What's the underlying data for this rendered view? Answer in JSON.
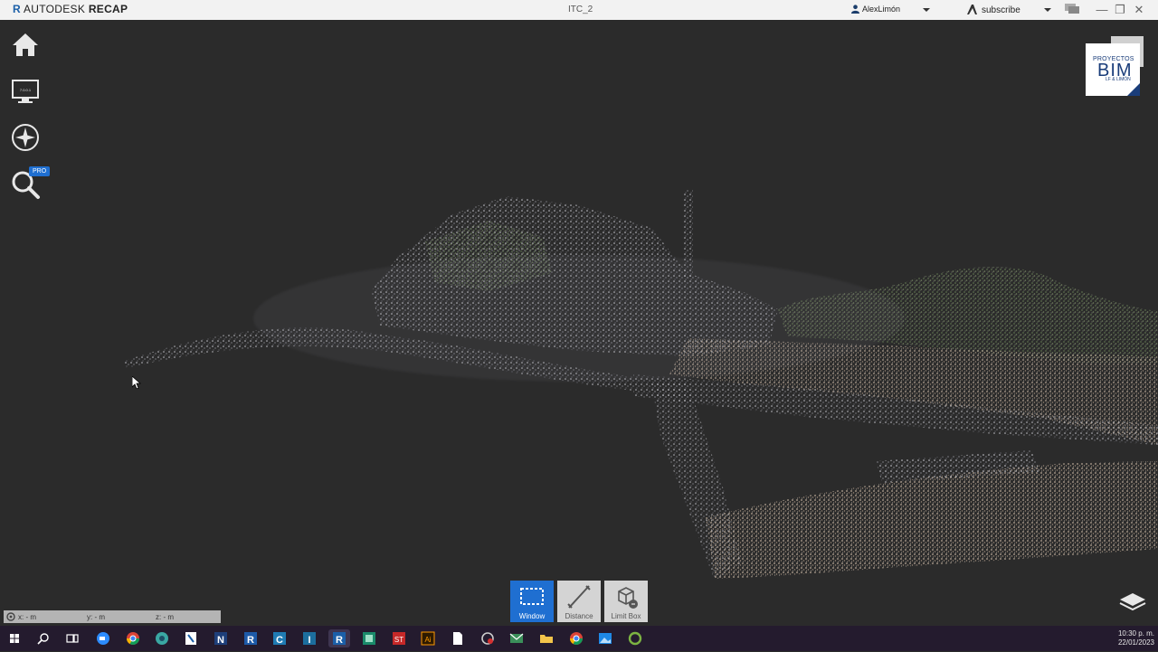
{
  "titlebar": {
    "brand_prefix": "AUTODESK",
    "brand_product": "RECAP",
    "document_title": "ITC_2",
    "user_name": "AlexLimón",
    "subscribe_label": "subscribe"
  },
  "left_tools": [
    {
      "name": "home-icon"
    },
    {
      "name": "monitor-icon"
    },
    {
      "name": "compass-icon"
    },
    {
      "name": "search-icon"
    }
  ],
  "pro_badge": "PRO",
  "logo": {
    "line1": "PROYECTOS",
    "line2": "BIM",
    "line3": "LF & LIMÓN"
  },
  "bottom_tools": [
    {
      "label": "Window",
      "active": true
    },
    {
      "label": "Distance",
      "active": false
    },
    {
      "label": "Limit Box",
      "active": false
    }
  ],
  "coordinates": {
    "x": "x:  -  m",
    "y": "y:  -  m",
    "z": "z:  -  m"
  },
  "clock": {
    "time": "10:30 p. m.",
    "date": "22/01/2023"
  },
  "colors": {
    "accent": "#1f6fd1",
    "viewport_bg": "#2b2b2b",
    "taskbar_bg": "#241b2e"
  },
  "taskbar_icons": [
    "windows-start-icon",
    "search-icon",
    "task-view-icon",
    "zoom-icon",
    "chrome-icon",
    "browser-icon",
    "app-icon",
    "navisworks-icon",
    "revit-icon",
    "civil3d-icon",
    "infraworks-icon",
    "recap-icon",
    "app-icon",
    "app-icon",
    "illustrator-icon",
    "file-icon",
    "app-icon",
    "mail-icon",
    "file-explorer-icon",
    "chrome-icon",
    "photos-icon",
    "app-icon"
  ]
}
